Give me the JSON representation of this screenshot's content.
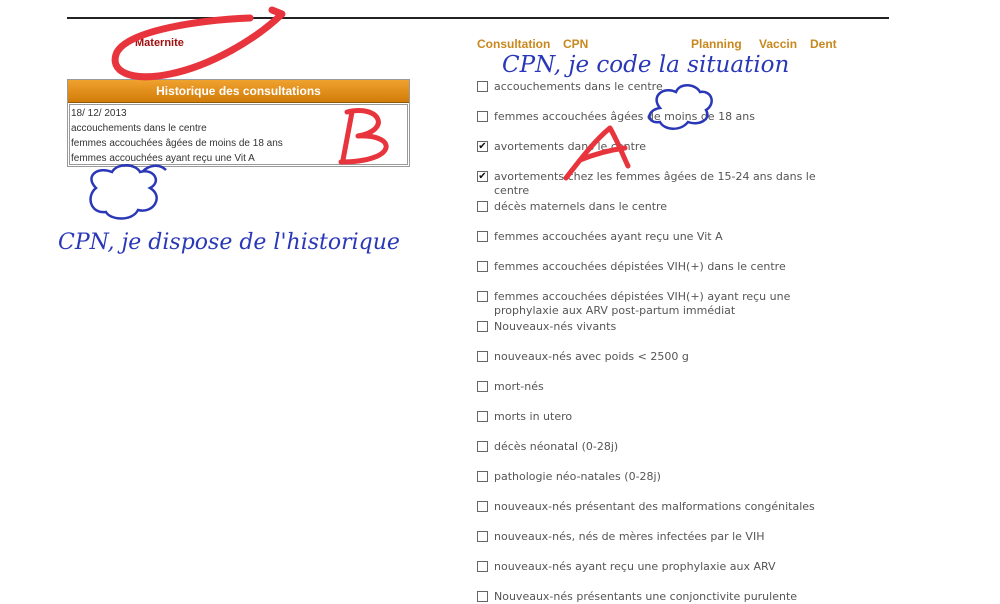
{
  "nav": {
    "maternite": "Maternite",
    "consultation": "Consultation",
    "cpn": "CPN",
    "planning": "Planning",
    "vaccin": "Vaccin",
    "dent": "Dent"
  },
  "history": {
    "title": "Historique des consultations",
    "lines": [
      "18/ 12/ 2013",
      "accouchements dans le centre",
      "femmes accouchées âgées de moins de 18 ans",
      "femmes accouchées ayant reçu une Vit A"
    ]
  },
  "checklist": [
    {
      "label": "accouchements dans le centre",
      "checked": false
    },
    {
      "label": "femmes accouchées âgées de moins de 18 ans",
      "checked": false
    },
    {
      "label": "avortements dans le centre",
      "checked": true
    },
    {
      "label": "avortements chez les femmes âgées de 15-24 ans dans le centre",
      "checked": true
    },
    {
      "label": "décès maternels dans le centre",
      "checked": false
    },
    {
      "label": "femmes accouchées ayant reçu une Vit A",
      "checked": false
    },
    {
      "label": "femmes accouchées dépistées VIH(+) dans le centre",
      "checked": false
    },
    {
      "label": "femmes accouchées dépistées VIH(+) ayant reçu une prophylaxie aux ARV post-partum immédiat",
      "checked": false
    },
    {
      "label": "Nouveaux-nés vivants",
      "checked": false
    },
    {
      "label": "nouveaux-nés avec poids < 2500 g",
      "checked": false
    },
    {
      "label": "mort-nés",
      "checked": false
    },
    {
      "label": "morts in utero",
      "checked": false
    },
    {
      "label": "décès néonatal (0-28j)",
      "checked": false
    },
    {
      "label": "pathologie néo-natales (0-28j)",
      "checked": false
    },
    {
      "label": "nouveaux-nés présentant des malformations congénitales",
      "checked": false
    },
    {
      "label": "nouveaux-nés, nés de mères infectées par le VIH",
      "checked": false
    },
    {
      "label": "nouveaux-nés ayant reçu une prophylaxie aux ARV",
      "checked": false
    },
    {
      "label": "Nouveaux-nés présentants une conjonctivite purulente",
      "checked": false
    }
  ],
  "annotations": {
    "cpn_situation": "CPN, je code la situation",
    "cpn_historique": "CPN, je dispose de l'historique",
    "letter_a": "A",
    "letter_b": "B",
    "letter_c": "C"
  },
  "colors": {
    "nav": "#c9881e",
    "maternite": "#a01010",
    "header_orange": "#e0901c",
    "annotation_blue": "#2a38b8",
    "annotation_red": "#e8343c"
  }
}
